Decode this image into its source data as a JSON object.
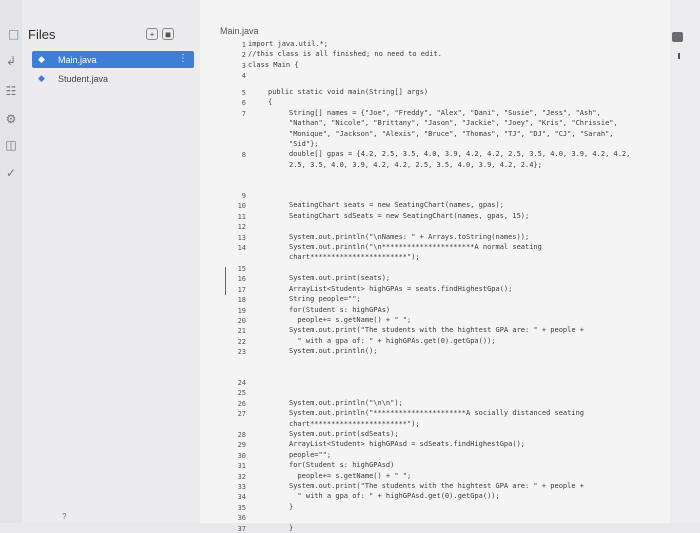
{
  "sidebar": {
    "title": "Files",
    "files": [
      {
        "name": "Main.java",
        "active": true
      },
      {
        "name": "Student.java",
        "active": false
      }
    ],
    "help": "?"
  },
  "editor": {
    "tab": "Main.java",
    "lines": [
      {
        "n": "1",
        "text": "import java.util.*;"
      },
      {
        "n": "2",
        "text": "//this class is all finished; no need to edit."
      },
      {
        "n": "3",
        "text": "class Main {"
      },
      {
        "n": "4",
        "text": ""
      },
      {
        "n": "5",
        "text": "public static void main(String[] args)"
      },
      {
        "n": "6",
        "text": "{"
      },
      {
        "n": "7",
        "text": "String[] names = {\"Joe\", \"Freddy\", \"Alex\", \"Dani\", \"Susie\", \"Jess\", \"Ash\","
      },
      {
        "n": "",
        "text": "\"Nathan\", \"Nicole\", \"Brittany\", \"Jason\", \"Jackie\", \"Joey\", \"Kris\", \"Chrissie\","
      },
      {
        "n": "",
        "text": "\"Monique\", \"Jackson\", \"Alexis\", \"Bruce\", \"Thomas\", \"TJ\", \"DJ\", \"CJ\", \"Sarah\","
      },
      {
        "n": "",
        "text": "\"Sid\"};"
      },
      {
        "n": "8",
        "text": "double[] gpas = {4.2, 2.5, 3.5, 4.0, 3.9, 4.2, 4.2, 2.5, 3.5, 4.0, 3.9, 4.2, 4.2,"
      },
      {
        "n": "",
        "text": "2.5, 3.5, 4.0, 3.9, 4.2, 4.2, 2.5, 3.5, 4.0, 3.9, 4.2, 2.4};"
      },
      {
        "n": "9",
        "text": ""
      },
      {
        "n": "10",
        "text": "SeatingChart seats = new SeatingChart(names, gpas);"
      },
      {
        "n": "11",
        "text": "SeatingChart sdSeats = new SeatingChart(names, gpas, 15);"
      },
      {
        "n": "12",
        "text": ""
      },
      {
        "n": "13",
        "text": "System.out.println(\"\\nNames: \" + Arrays.toString(names));"
      },
      {
        "n": "14",
        "text": "System.out.println(\"\\n**********************A normal seating"
      },
      {
        "n": "",
        "text": "chart***********************\");"
      },
      {
        "n": "15",
        "text": ""
      },
      {
        "n": "16",
        "text": "System.out.print(seats);"
      },
      {
        "n": "17",
        "text": "ArrayList<Student> highGPAs = seats.findHighestGpa();"
      },
      {
        "n": "18",
        "text": "String people=\"\";"
      },
      {
        "n": "19",
        "text": "for(Student s: highGPAs)"
      },
      {
        "n": "20",
        "text": "  people+= s.getName() + \" \";"
      },
      {
        "n": "21",
        "text": "System.out.print(\"The students with the hightest GPA are: \" + people +"
      },
      {
        "n": "22",
        "text": "  \" with a gpa of: \" + highGPAs.get(0).getGpa());"
      },
      {
        "n": "23",
        "text": "System.out.println();"
      },
      {
        "n": "24",
        "text": ""
      },
      {
        "n": "25",
        "text": ""
      },
      {
        "n": "26",
        "text": "System.out.println(\"\\n\\n\");"
      },
      {
        "n": "27",
        "text": "System.out.println(\"**********************A socially distanced seating"
      },
      {
        "n": "",
        "text": "chart***********************\");"
      },
      {
        "n": "28",
        "text": "System.out.print(sdSeats);"
      },
      {
        "n": "29",
        "text": "ArrayList<Student> highGPAsd = sdSeats.findHighestGpa();"
      },
      {
        "n": "30",
        "text": "people=\"\";"
      },
      {
        "n": "31",
        "text": "for(Student s: highGPAsd)"
      },
      {
        "n": "32",
        "text": "  people+= s.getName() + \" \";"
      },
      {
        "n": "33",
        "text": "System.out.print(\"The students with the hightest GPA are: \" + people +"
      },
      {
        "n": "34",
        "text": "  \" with a gpa of: \" + highGPAsd.get(0).getGpa());"
      },
      {
        "n": "35",
        "text": "}"
      },
      {
        "n": "36",
        "text": ""
      },
      {
        "n": "37",
        "text": "}"
      }
    ]
  },
  "icons": {
    "files": "file-icon",
    "activity": [
      "share-icon",
      "package-icon",
      "settings-icon",
      "database-icon",
      "check-icon"
    ],
    "toolbar": [
      "new-file-icon",
      "new-folder-icon"
    ]
  }
}
